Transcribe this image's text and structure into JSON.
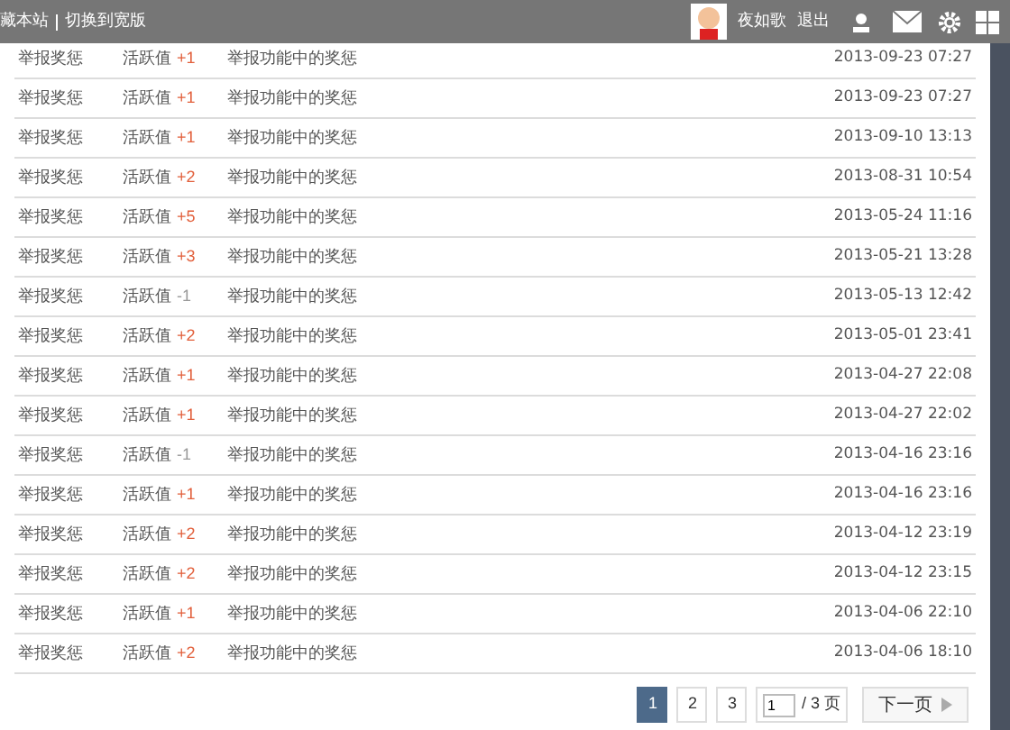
{
  "top_bar": {
    "links": [
      "藏本站",
      "切换到宽版"
    ],
    "user_name": "夜如歌",
    "logout": "退出"
  },
  "rows": [
    {
      "type": "举报奖惩",
      "label": "活跃值",
      "change": "+1",
      "positive": true,
      "reason": "举报功能中的奖惩",
      "time": "2013-09-23 07:27"
    },
    {
      "type": "举报奖惩",
      "label": "活跃值",
      "change": "+1",
      "positive": true,
      "reason": "举报功能中的奖惩",
      "time": "2013-09-23 07:27"
    },
    {
      "type": "举报奖惩",
      "label": "活跃值",
      "change": "+1",
      "positive": true,
      "reason": "举报功能中的奖惩",
      "time": "2013-09-10 13:13"
    },
    {
      "type": "举报奖惩",
      "label": "活跃值",
      "change": "+2",
      "positive": true,
      "reason": "举报功能中的奖惩",
      "time": "2013-08-31 10:54"
    },
    {
      "type": "举报奖惩",
      "label": "活跃值",
      "change": "+5",
      "positive": true,
      "reason": "举报功能中的奖惩",
      "time": "2013-05-24 11:16"
    },
    {
      "type": "举报奖惩",
      "label": "活跃值",
      "change": "+3",
      "positive": true,
      "reason": "举报功能中的奖惩",
      "time": "2013-05-21 13:28"
    },
    {
      "type": "举报奖惩",
      "label": "活跃值",
      "change": "-1",
      "positive": false,
      "reason": "举报功能中的奖惩",
      "time": "2013-05-13 12:42"
    },
    {
      "type": "举报奖惩",
      "label": "活跃值",
      "change": "+2",
      "positive": true,
      "reason": "举报功能中的奖惩",
      "time": "2013-05-01 23:41"
    },
    {
      "type": "举报奖惩",
      "label": "活跃值",
      "change": "+1",
      "positive": true,
      "reason": "举报功能中的奖惩",
      "time": "2013-04-27 22:08"
    },
    {
      "type": "举报奖惩",
      "label": "活跃值",
      "change": "+1",
      "positive": true,
      "reason": "举报功能中的奖惩",
      "time": "2013-04-27 22:02"
    },
    {
      "type": "举报奖惩",
      "label": "活跃值",
      "change": "-1",
      "positive": false,
      "reason": "举报功能中的奖惩",
      "time": "2013-04-16 23:16"
    },
    {
      "type": "举报奖惩",
      "label": "活跃值",
      "change": "+1",
      "positive": true,
      "reason": "举报功能中的奖惩",
      "time": "2013-04-16 23:16"
    },
    {
      "type": "举报奖惩",
      "label": "活跃值",
      "change": "+2",
      "positive": true,
      "reason": "举报功能中的奖惩",
      "time": "2013-04-12 23:19"
    },
    {
      "type": "举报奖惩",
      "label": "活跃值",
      "change": "+2",
      "positive": true,
      "reason": "举报功能中的奖惩",
      "time": "2013-04-12 23:15"
    },
    {
      "type": "举报奖惩",
      "label": "活跃值",
      "change": "+1",
      "positive": true,
      "reason": "举报功能中的奖惩",
      "time": "2013-04-06 22:10"
    },
    {
      "type": "举报奖惩",
      "label": "活跃值",
      "change": "+2",
      "positive": true,
      "reason": "举报功能中的奖惩",
      "time": "2013-04-06 18:10"
    }
  ],
  "pagination": {
    "pages": [
      {
        "label": "1",
        "selected": true
      },
      {
        "label": "2",
        "selected": false
      },
      {
        "label": "3",
        "selected": false
      }
    ],
    "page_input": "1",
    "total": "/ 3 页",
    "next": "下一页"
  }
}
